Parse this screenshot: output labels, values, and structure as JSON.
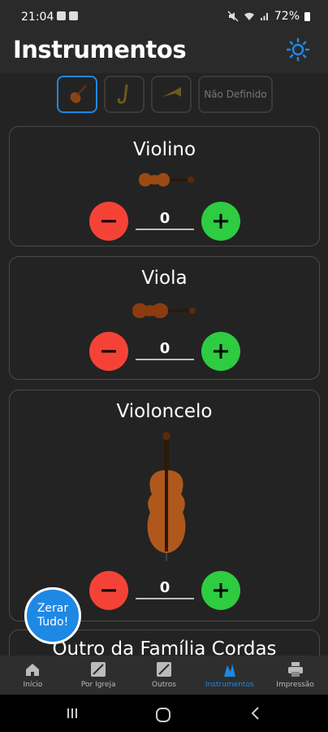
{
  "status": {
    "time": "21:04",
    "battery": "72%"
  },
  "header": {
    "title": "Instrumentos"
  },
  "filters": {
    "undefined_label": "Não Definido"
  },
  "cards": [
    {
      "name": "Violino",
      "count": "0"
    },
    {
      "name": "Viola",
      "count": "0"
    },
    {
      "name": "Violoncelo",
      "count": "0"
    },
    {
      "name": "Outro da Família Cordas"
    }
  ],
  "fab": {
    "line1": "Zerar",
    "line2": "Tudo!"
  },
  "nav": [
    {
      "label": "Início",
      "icon": "home-icon"
    },
    {
      "label": "Por Igreja",
      "icon": "stats-icon"
    },
    {
      "label": "Outros",
      "icon": "stats-icon"
    },
    {
      "label": "Instrumentos",
      "icon": "instruments-icon"
    },
    {
      "label": "Impressão",
      "icon": "printer-icon"
    }
  ],
  "colors": {
    "accent": "#1e88e5",
    "minus": "#f44336",
    "plus": "#2ecc40"
  }
}
